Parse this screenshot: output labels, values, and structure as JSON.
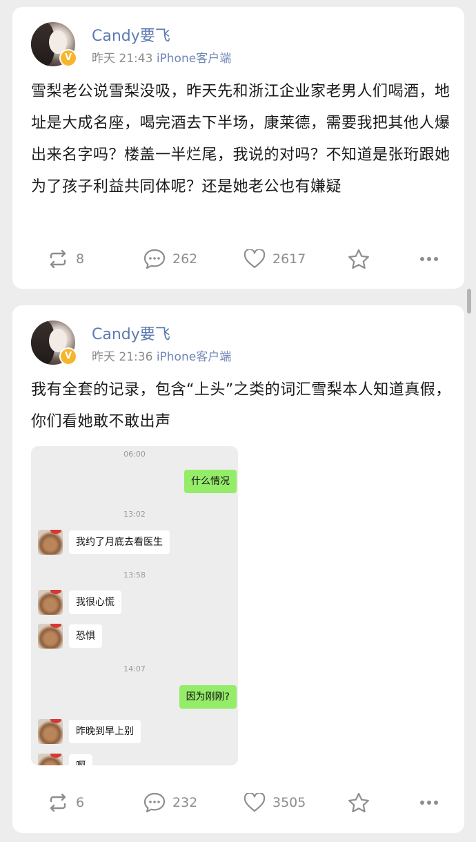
{
  "posts": [
    {
      "author": "Candy要飞",
      "time": "昨天 21:43",
      "source": "iPhone客户端",
      "text": "雪梨老公说雪梨没吸，昨天先和浙江企业家老男人们喝酒，地址是大成名座，喝完酒去下半场，康莱德，需要我把其他人爆出来名字吗？楼盖一半烂尾，我说的对吗？不知道是张珩跟她为了孩子利益共同体呢？还是她老公也有嫌疑",
      "reposts": "8",
      "comments": "262",
      "likes": "2617"
    },
    {
      "author": "Candy要飞",
      "time": "昨天 21:36",
      "source": "iPhone客户端",
      "text": "我有全套的记录，包含“上头”之类的词汇雪梨本人知道真假，你们看她敢不敢出声",
      "reposts": "6",
      "comments": "232",
      "likes": "3505",
      "chat": {
        "timestamps": [
          "06:00",
          "13:02",
          "13:58",
          "14:07"
        ],
        "messages": [
          "什么情况",
          "我约了月底去看医生",
          "我很心慌",
          "恐惧",
          "因为刚刚?",
          "昨晚到早上别",
          "啊"
        ]
      }
    }
  ],
  "icons": {
    "repost": "repost-icon",
    "comment": "comment-icon",
    "like": "heart-icon",
    "favorite": "star-icon",
    "more": "more-icon",
    "verified": "verified-badge-icon"
  },
  "colors": {
    "name": "#5b79b2",
    "verified_badge": "#f7b52c",
    "chat_my_bubble": "#95ec69"
  }
}
